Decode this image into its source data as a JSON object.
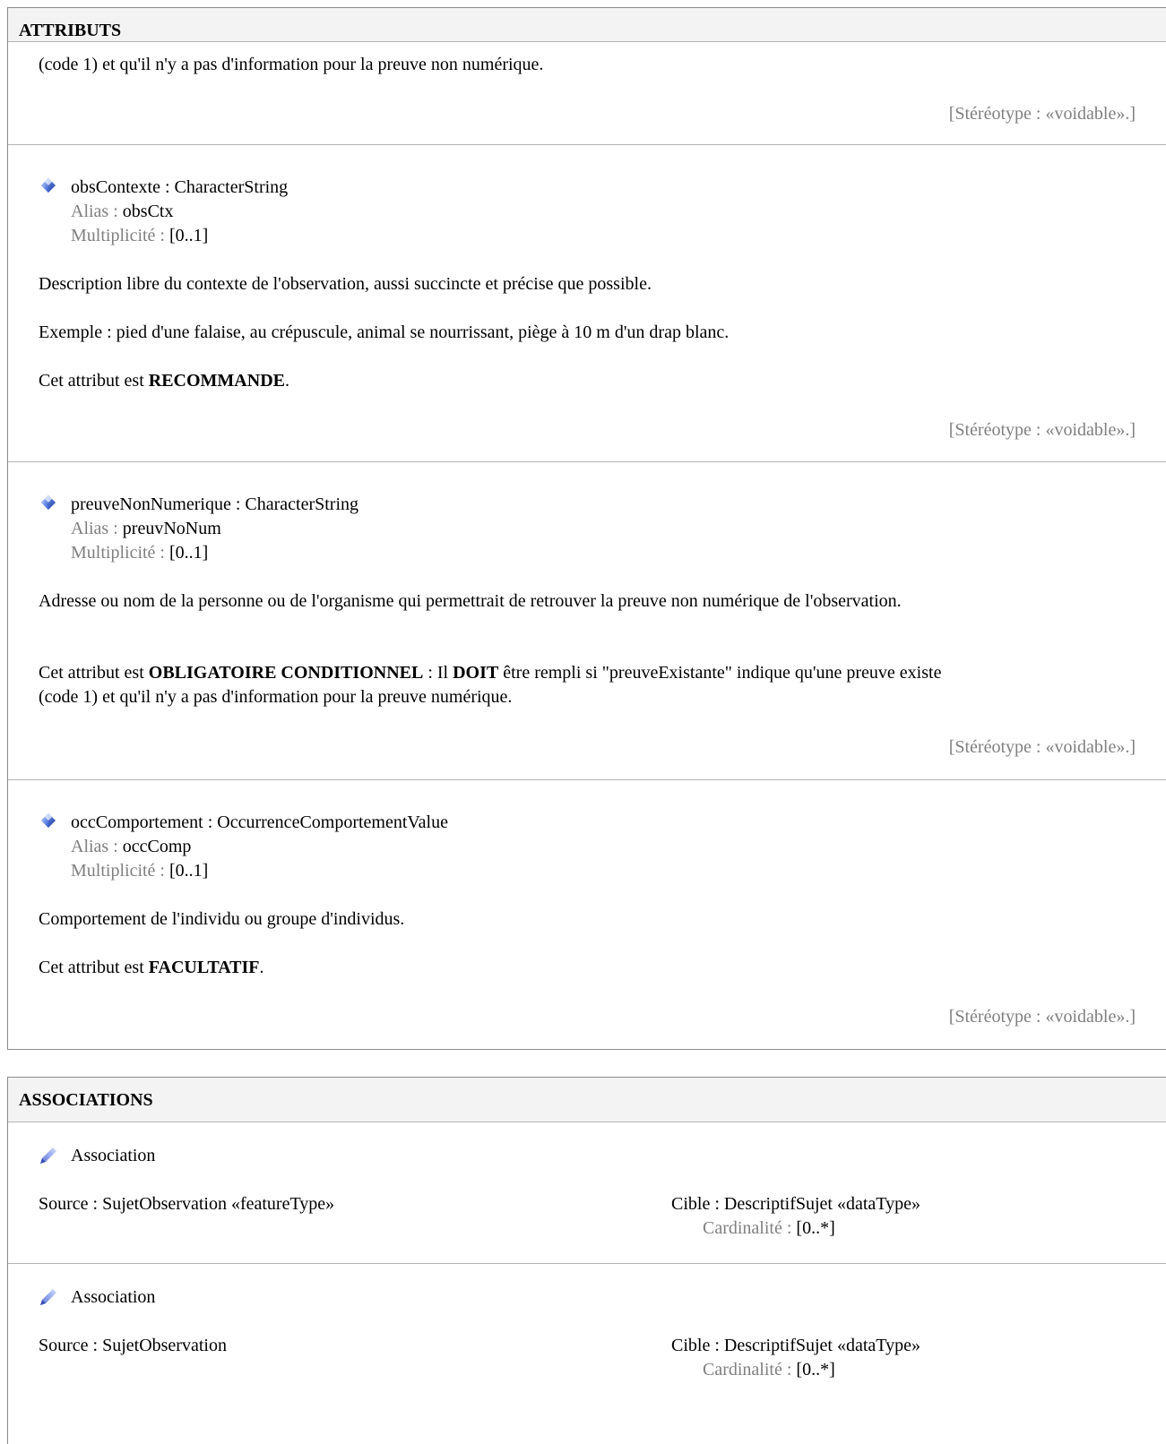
{
  "attributes": {
    "header": "ATTRIBUTS",
    "carryover": {
      "text": "(code 1) et qu'il n'y a pas d'information pour la preuve non numérique.",
      "stereotype": "[Stéréotype : «voidable».]"
    },
    "items": [
      {
        "signature": "obsContexte : CharacterString",
        "alias_label": "Alias : ",
        "alias": "obsCtx",
        "mult_label": "Multiplicité : ",
        "mult": "[0..1]",
        "description": "Description libre du contexte de l'observation, aussi succincte et précise que possible.",
        "example": "Exemple : pied d'une falaise, au crépuscule, animal se nourrissant, piège à 10 m d'un drap blanc.",
        "status_prefix": "Cet attribut est ",
        "status": "RECOMMANDE",
        "status_suffix": ".",
        "stereotype": "[Stéréotype : «voidable».]"
      },
      {
        "signature": "preuveNonNumerique : CharacterString",
        "alias_label": "Alias : ",
        "alias": "preuvNoNum",
        "mult_label": "Multiplicité : ",
        "mult": "[0..1]",
        "description": "Adresse ou nom de la personne ou de l'organisme qui permettrait de retrouver la preuve non numérique de l'observation.",
        "status_prefix": "Cet attribut est ",
        "status": "OBLIGATOIRE CONDITIONNEL",
        "status_mid": " : Il ",
        "status_must": "DOIT",
        "status_rest": " être rempli si \"preuveExistante\" indique qu'une preuve existe",
        "status_line2": "(code 1) et qu'il n'y a pas d'information pour la preuve numérique.",
        "stereotype": "[Stéréotype : «voidable».]"
      },
      {
        "signature": "occComportement : OccurrenceComportementValue",
        "alias_label": "Alias : ",
        "alias": "occComp",
        "mult_label": "Multiplicité : ",
        "mult": "[0..1]",
        "description": "Comportement de l'individu ou groupe d'individus.",
        "status_prefix": "Cet attribut est ",
        "status": "FACULTATIF",
        "status_suffix": ".",
        "stereotype": "[Stéréotype : «voidable».]"
      }
    ]
  },
  "associations": {
    "header": "ASSOCIATIONS",
    "items": [
      {
        "title": "Association",
        "source": "Source : SujetObservation «featureType»",
        "target": "Cible : DescriptifSujet «dataType»",
        "card_label": "Cardinalité : ",
        "card": "[0..*]"
      },
      {
        "title": "Association",
        "source": "Source : SujetObservation",
        "target": "Cible : DescriptifSujet «dataType»",
        "card_label": "Cardinalité : ",
        "card": "[0..*]"
      }
    ]
  },
  "icons": {
    "attribute": "attribute-diamond-icon",
    "association": "association-pencil-icon"
  }
}
